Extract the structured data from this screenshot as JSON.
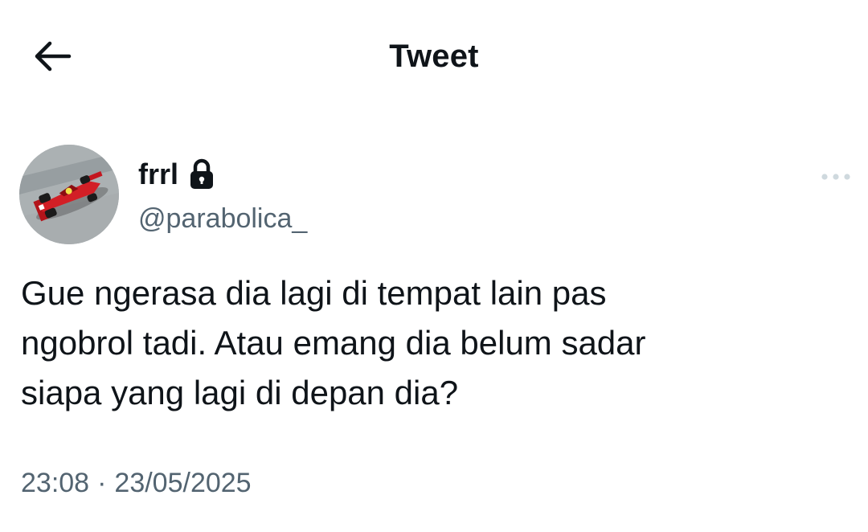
{
  "header": {
    "title": "Tweet",
    "back_icon": "arrow-left-icon"
  },
  "author": {
    "display_name": "frrl",
    "handle": "@parabolica_",
    "protected_icon": "lock-icon",
    "avatar_description_icon": "avatar-red-race-car"
  },
  "more_icon": "more-horizontal-icon",
  "tweet": {
    "text": "Gue ngerasa dia lagi di tempat lain pas\nngobrol tadi. Atau emang dia belum sadar\nsiapa yang lagi di depan dia?",
    "time": "23:08",
    "separator": "·",
    "date": "23/05/2025"
  },
  "colors": {
    "text_primary": "#0f1419",
    "text_secondary": "#536471",
    "more_dots": "#cfd9de",
    "background": "#ffffff"
  }
}
